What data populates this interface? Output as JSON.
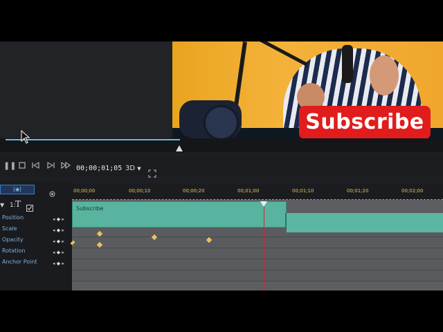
{
  "preview": {
    "overlay_text": "Subscribe"
  },
  "transport": {
    "timecode": "00;00;01;05",
    "mode": "3D",
    "icons": [
      "pause-icon",
      "stop-icon",
      "prev-frame-icon",
      "next-frame-icon",
      "fast-forward-icon",
      "fit-screen-icon"
    ]
  },
  "timeline": {
    "ruler_ticks": [
      "00;00;00",
      "00;00;10",
      "00;00;20",
      "00;01;00",
      "00;01;10",
      "00;01;20",
      "00;02;00"
    ],
    "track": {
      "number": "1:",
      "clip_label": "Subscribe"
    },
    "properties": [
      "Position",
      "Scale",
      "Opacity",
      "Rotation",
      "Anchor Point"
    ]
  },
  "colors": {
    "accent": "#5cc2e3",
    "clip": "#58b49e",
    "playhead": "#e02020",
    "keyframe": "#e6c25a",
    "property_label": "#7fb2dc"
  }
}
